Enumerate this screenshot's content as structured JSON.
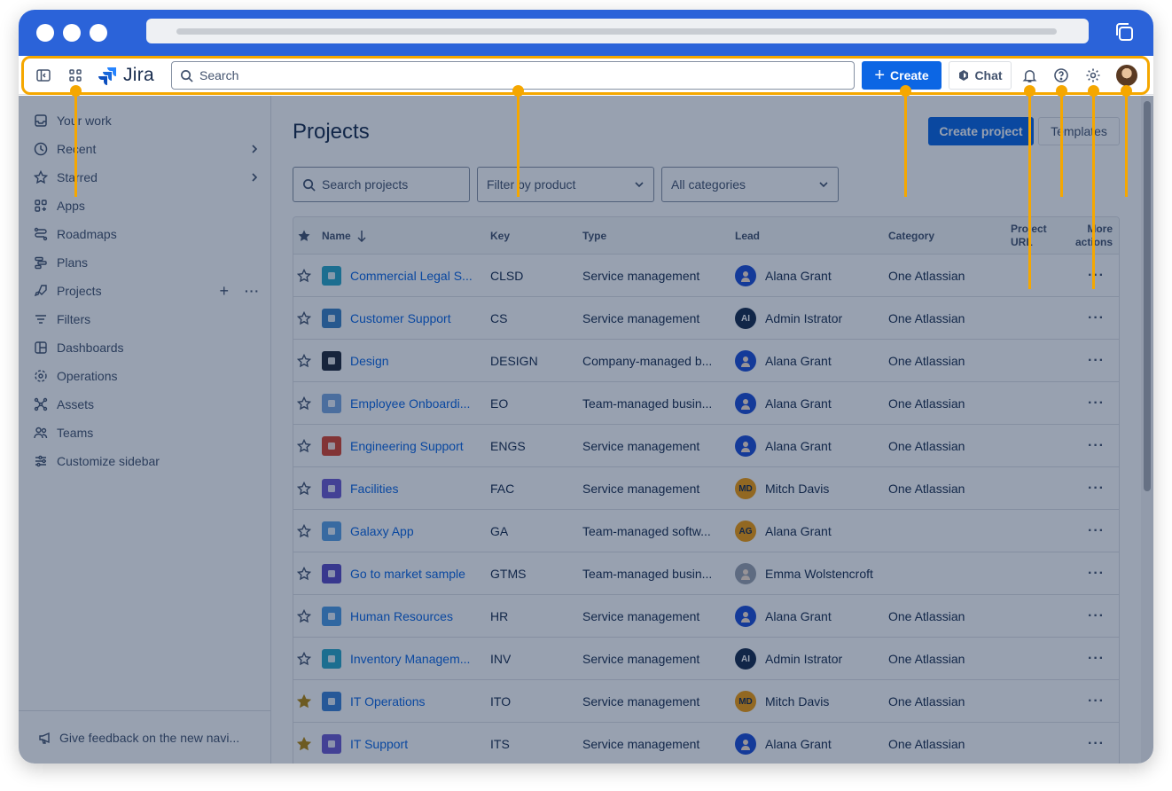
{
  "topnav": {
    "logo_text": "Jira",
    "search_placeholder": "Search",
    "create_label": "Create",
    "chat_label": "Chat"
  },
  "sidebar": {
    "items": [
      {
        "label": "Your work",
        "icon": "inbox-icon"
      },
      {
        "label": "Recent",
        "icon": "clock-icon",
        "chevron": true
      },
      {
        "label": "Starred",
        "icon": "star-icon",
        "chevron": true
      },
      {
        "label": "Apps",
        "icon": "apps-icon"
      },
      {
        "label": "Roadmaps",
        "icon": "roadmap-icon"
      },
      {
        "label": "Plans",
        "icon": "plans-icon"
      },
      {
        "label": "Projects",
        "icon": "rocket-icon",
        "actions": true
      },
      {
        "label": "Filters",
        "icon": "filter-icon"
      },
      {
        "label": "Dashboards",
        "icon": "dashboard-icon"
      },
      {
        "label": "Operations",
        "icon": "operations-icon"
      },
      {
        "label": "Assets",
        "icon": "assets-icon"
      },
      {
        "label": "Teams",
        "icon": "teams-icon"
      },
      {
        "label": "Customize sidebar",
        "icon": "customize-icon"
      }
    ],
    "feedback_label": "Give feedback on the new navi..."
  },
  "main": {
    "title": "Projects",
    "create_project_label": "Create project",
    "templates_label": "Templates",
    "search_projects_placeholder": "Search projects",
    "filter_product_label": "Filter by product",
    "categories_label": "All categories"
  },
  "table": {
    "headers": {
      "name": "Name",
      "key": "Key",
      "type": "Type",
      "lead": "Lead",
      "category": "Category",
      "url_line1": "Project",
      "url_line2": "URL",
      "more_line1": "More",
      "more_line2": "actions"
    },
    "rows": [
      {
        "starred": false,
        "name": "Commercial Legal S...",
        "key": "CLSD",
        "type": "Service management",
        "lead": "Alana Grant",
        "lead_initials": "",
        "lead_color": "#1d4ed8",
        "category": "One Atlassian",
        "icon_color": "#2aa7c9"
      },
      {
        "starred": false,
        "name": "Customer Support",
        "key": "CS",
        "type": "Service management",
        "lead": "Admin Istrator",
        "lead_initials": "AI",
        "lead_color": "#172b4d",
        "category": "One Atlassian",
        "icon_color": "#3b82c4"
      },
      {
        "starred": false,
        "name": "Design",
        "key": "DESIGN",
        "type": "Company-managed b...",
        "lead": "Alana Grant",
        "lead_initials": "",
        "lead_color": "#1d4ed8",
        "category": "One Atlassian",
        "icon_color": "#1f2937"
      },
      {
        "starred": false,
        "name": "Employee Onboardi...",
        "key": "EO",
        "type": "Team-managed busin...",
        "lead": "Alana Grant",
        "lead_initials": "",
        "lead_color": "#1d4ed8",
        "category": "One Atlassian",
        "icon_color": "#7aa7e0"
      },
      {
        "starred": false,
        "name": "Engineering Support",
        "key": "ENGS",
        "type": "Service management",
        "lead": "Alana Grant",
        "lead_initials": "",
        "lead_color": "#1d4ed8",
        "category": "One Atlassian",
        "icon_color": "#d9442d"
      },
      {
        "starred": false,
        "name": "Facilities",
        "key": "FAC",
        "type": "Service management",
        "lead": "Mitch Davis",
        "lead_initials": "MD",
        "lead_color": "#f59e0b",
        "category": "One Atlassian",
        "icon_color": "#6d5bd0"
      },
      {
        "starred": false,
        "name": "Galaxy App",
        "key": "GA",
        "type": "Team-managed softw...",
        "lead": "Alana Grant",
        "lead_initials": "AG",
        "lead_color": "#f59e0b",
        "category": "",
        "icon_color": "#5aa0e6"
      },
      {
        "starred": false,
        "name": "Go to market sample",
        "key": "GTMS",
        "type": "Team-managed busin...",
        "lead": "Emma Wolstencroft",
        "lead_initials": "",
        "lead_color": "#9ca3af",
        "category": "",
        "icon_color": "#5b4bc4"
      },
      {
        "starred": false,
        "name": "Human Resources",
        "key": "HR",
        "type": "Service management",
        "lead": "Alana Grant",
        "lead_initials": "",
        "lead_color": "#1d4ed8",
        "category": "One Atlassian",
        "icon_color": "#4d9be6"
      },
      {
        "starred": false,
        "name": "Inventory Managem...",
        "key": "INV",
        "type": "Service management",
        "lead": "Admin Istrator",
        "lead_initials": "AI",
        "lead_color": "#172b4d",
        "category": "One Atlassian",
        "icon_color": "#2aa7c9"
      },
      {
        "starred": true,
        "name": "IT Operations",
        "key": "ITO",
        "type": "Service management",
        "lead": "Mitch Davis",
        "lead_initials": "MD",
        "lead_color": "#f59e0b",
        "category": "One Atlassian",
        "icon_color": "#3b82d6"
      },
      {
        "starred": true,
        "name": "IT Support",
        "key": "ITS",
        "type": "Service management",
        "lead": "Alana Grant",
        "lead_initials": "",
        "lead_color": "#1d4ed8",
        "category": "One Atlassian",
        "icon_color": "#6d5bd0"
      }
    ]
  },
  "colors": {
    "highlight": "#f5a700",
    "primary": "#0c66e4",
    "chrome": "#2b63d9"
  }
}
